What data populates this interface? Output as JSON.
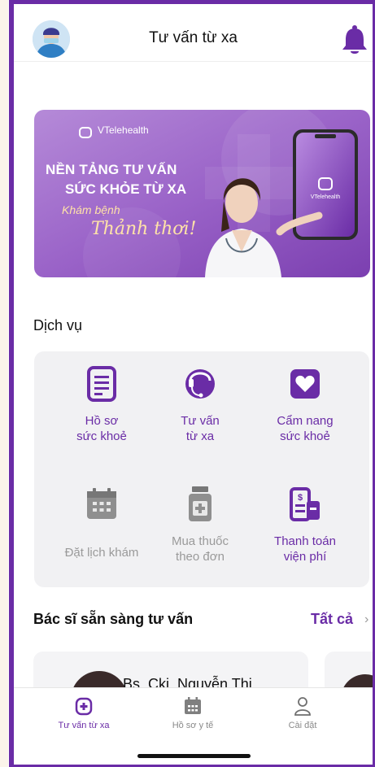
{
  "header": {
    "title": "Tư vấn từ xa",
    "avatar_icon": "doctor-avatar",
    "bell_icon": "bell-icon"
  },
  "banner": {
    "brand": "VTelehealth",
    "headline_1": "NỀN TẢNG TƯ VẤN",
    "headline_2": "SỨC KHỎE TỪ XA",
    "tagline_1": "Khám bệnh",
    "tagline_2": "Thảnh thơi!",
    "phone_brand": "VTelehealth"
  },
  "services": {
    "title": "Dịch vụ",
    "items": [
      {
        "line1": "Hồ sơ",
        "line2": "sức khoẻ",
        "icon": "document-icon",
        "enabled": true
      },
      {
        "line1": "Tư vấn",
        "line2": "từ xa",
        "icon": "headset-icon",
        "enabled": true
      },
      {
        "line1": "Cẩm nang",
        "line2": "sức khoẻ",
        "icon": "heart-icon",
        "enabled": true
      },
      {
        "line1": "Đặt lịch khám",
        "line2": "",
        "icon": "calendar-icon",
        "enabled": false
      },
      {
        "line1": "Mua thuốc",
        "line2": "theo đơn",
        "icon": "medicine-icon",
        "enabled": false
      },
      {
        "line1": "Thanh toán",
        "line2": "viện phí",
        "icon": "bill-icon",
        "enabled": true
      }
    ]
  },
  "doctors": {
    "title": "Bác sĩ sẵn sàng tư vấn",
    "see_all": "Tất cả",
    "chevron": "›",
    "items": [
      {
        "name": "Bs. Cki. Nguyễn Thi..."
      }
    ]
  },
  "tabbar": {
    "items": [
      {
        "label": "Tư vấn từ xa",
        "icon": "consult-icon",
        "active": true
      },
      {
        "label": "Hồ sơ y tế",
        "icon": "calendar-icon",
        "active": false
      },
      {
        "label": "Cài đặt",
        "icon": "user-icon",
        "active": false
      }
    ]
  },
  "colors": {
    "primary": "#6a2ca6",
    "disabled": "#9a9a9a",
    "panel": "#f1f1f3"
  }
}
